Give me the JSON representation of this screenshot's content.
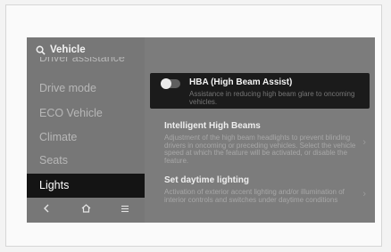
{
  "header": {
    "title": "Vehicle",
    "search_icon": "search-icon"
  },
  "sidebar": {
    "items": [
      {
        "label": "Driver assistance",
        "state": "clipped"
      },
      {
        "label": "Drive mode"
      },
      {
        "label": "ECO Vehicle"
      },
      {
        "label": "Climate"
      },
      {
        "label": "Seats"
      },
      {
        "label": "Lights",
        "state": "selected"
      }
    ]
  },
  "nav": {
    "back_icon": "chevron-left-icon",
    "home_icon": "home-icon",
    "menu_icon": "menu-icon"
  },
  "content": {
    "hba": {
      "title": "HBA (High Beam Assist)",
      "description": "Assistance in reducing high beam glare to oncoming vehicles.",
      "toggle_on": false
    },
    "intelligent": {
      "title": "Intelligent High Beams",
      "description": "Adjustment of the high beam headlights to prevent blinding drivers in oncoming or preceding vehicles. Select the vehicle speed at which the feature will be activated, or disable the feature."
    },
    "daytime": {
      "title": "Set daytime lighting",
      "description": "Activation of exterior accent lighting and/or illumination of interior controls and switches under daytime conditions"
    }
  },
  "colors": {
    "screen_bg": "#7c7c7c",
    "selected_item_bg": "#141414",
    "card_bg": "#1b1b1b"
  }
}
